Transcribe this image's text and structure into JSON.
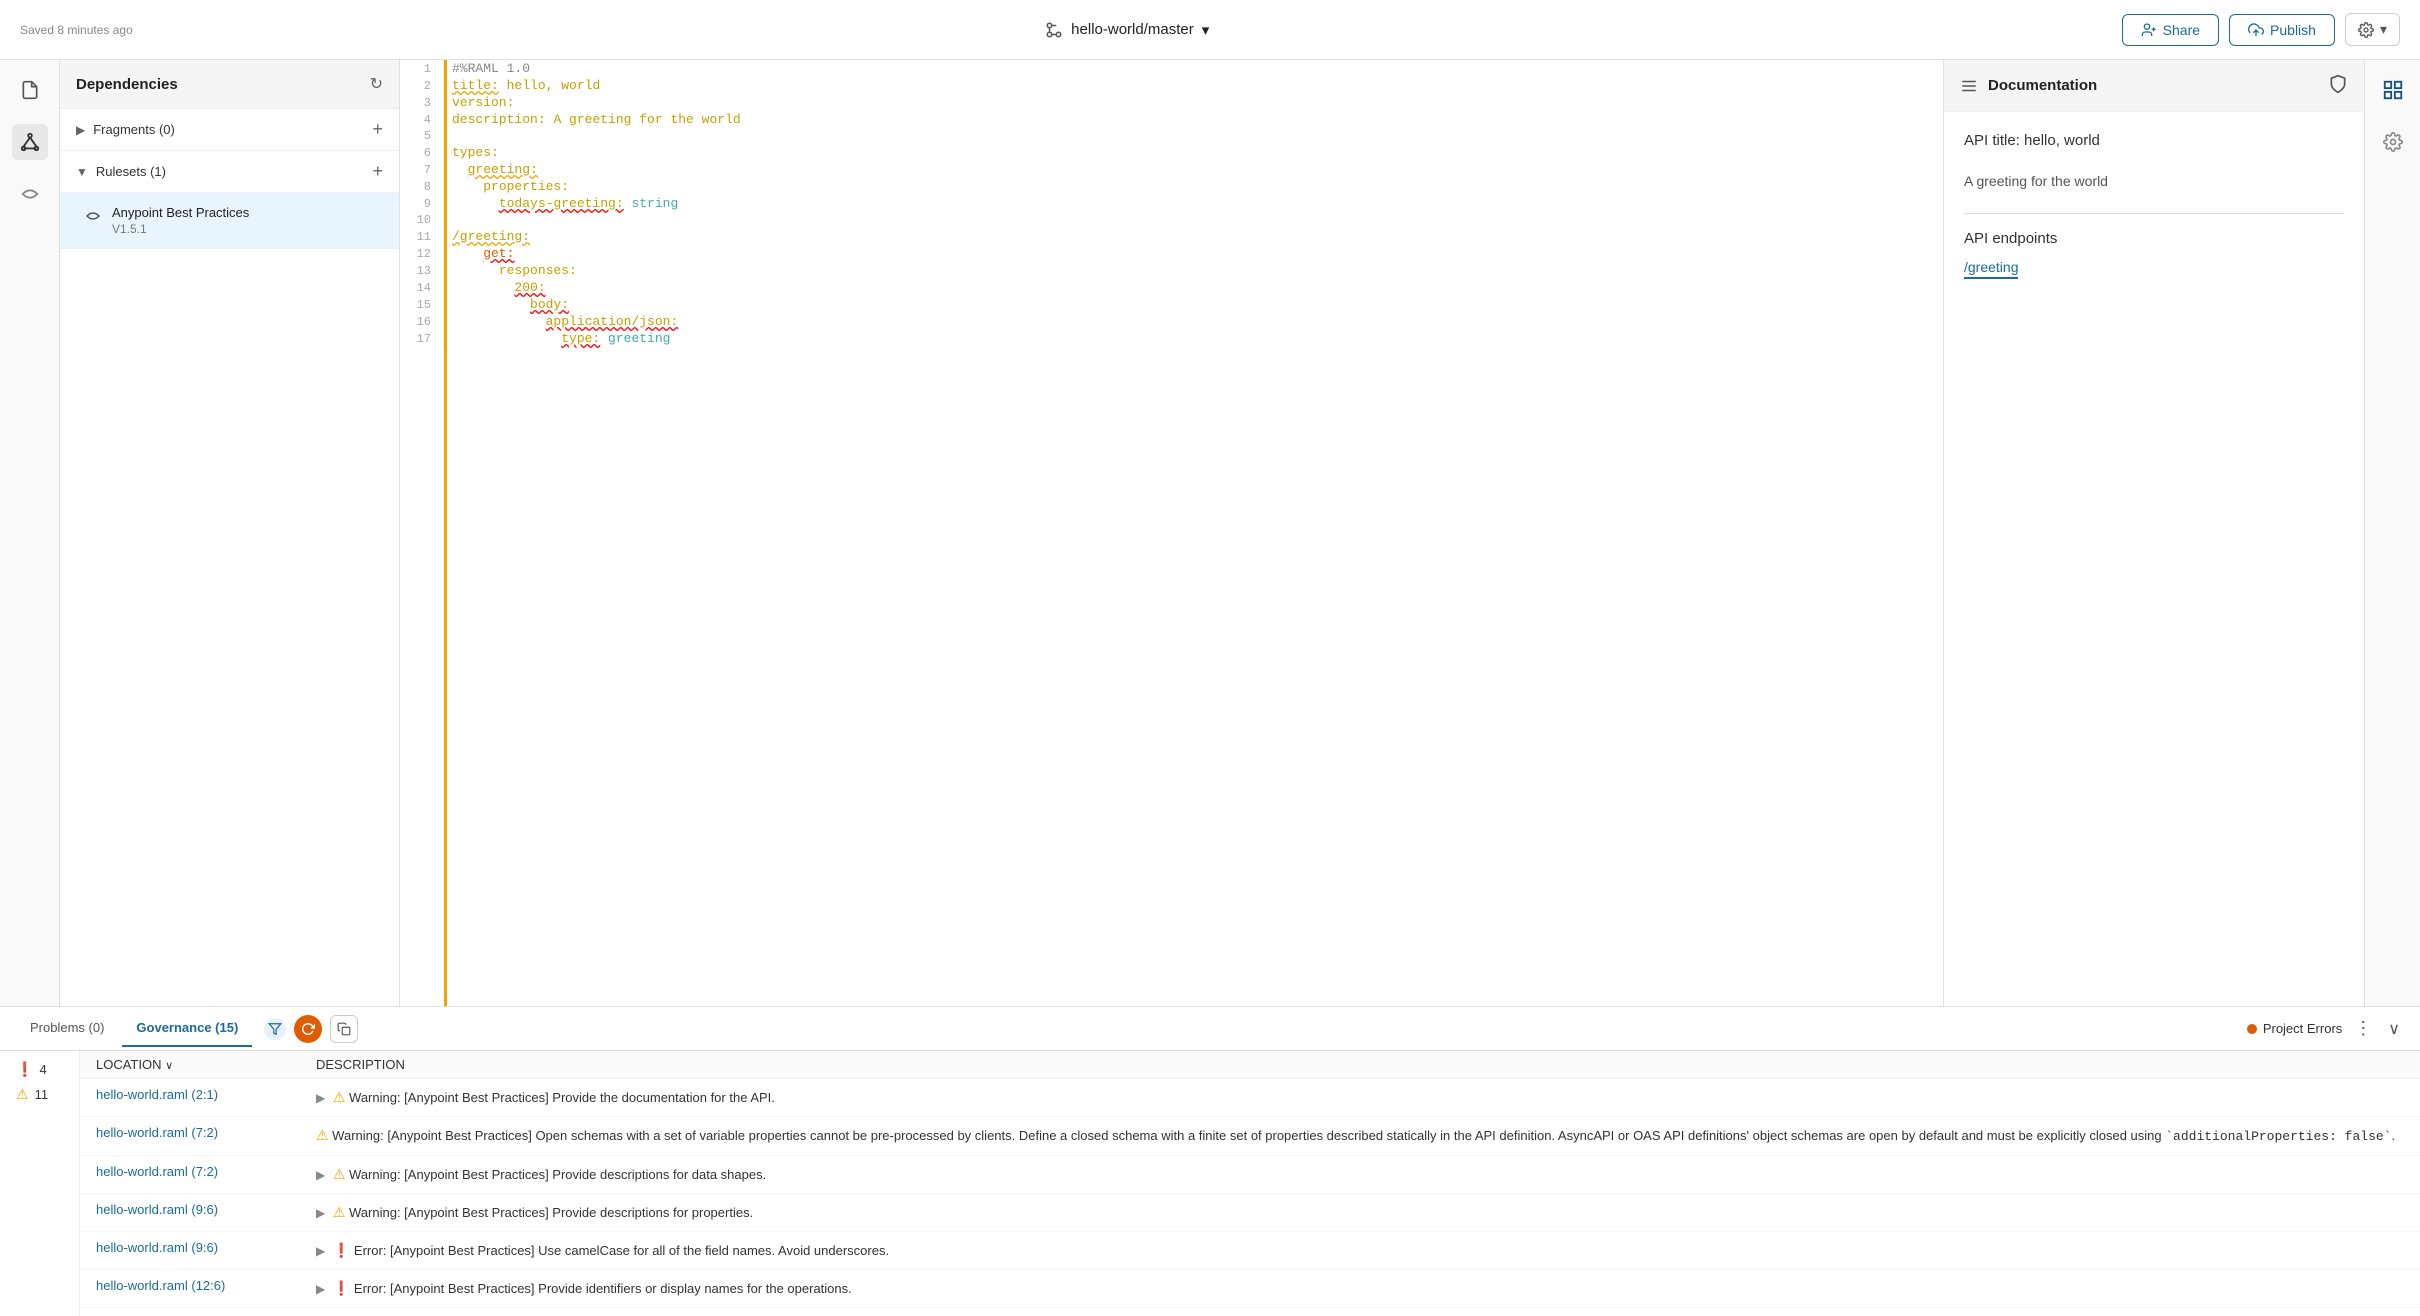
{
  "topbar": {
    "saved_text": "Saved 8 minutes ago",
    "repo": "hello-world/master",
    "share_label": "Share",
    "publish_label": "Publish"
  },
  "sidebar": {
    "icons": [
      "document",
      "graph",
      "anypoint"
    ]
  },
  "dependencies": {
    "title": "Dependencies",
    "fragments": {
      "label": "Fragments (0)",
      "count": 0
    },
    "rulesets": {
      "label": "Rulesets (1)",
      "count": 1
    },
    "ruleset_entry": {
      "name": "Anypoint Best Practices",
      "version": "V1.5.1"
    }
  },
  "editor": {
    "lines": [
      {
        "num": 1,
        "content": "#%RAML 1.0"
      },
      {
        "num": 2,
        "content": "title: hello, world"
      },
      {
        "num": 3,
        "content": "version:"
      },
      {
        "num": 4,
        "content": "description: A greeting for the world"
      },
      {
        "num": 5,
        "content": ""
      },
      {
        "num": 6,
        "content": "types:"
      },
      {
        "num": 7,
        "content": "  greeting:"
      },
      {
        "num": 8,
        "content": "    properties:"
      },
      {
        "num": 9,
        "content": "      todays-greeting: string"
      },
      {
        "num": 10,
        "content": ""
      },
      {
        "num": 11,
        "content": "/greeting:"
      },
      {
        "num": 12,
        "content": "    get:"
      },
      {
        "num": 13,
        "content": "      responses:"
      },
      {
        "num": 14,
        "content": "        200:"
      },
      {
        "num": 15,
        "content": "          body:"
      },
      {
        "num": 16,
        "content": "            application/json:"
      },
      {
        "num": 17,
        "content": "              type: greeting"
      }
    ]
  },
  "documentation": {
    "title": "Documentation",
    "api_title_label": "API title: hello, world",
    "description": "A greeting for the world",
    "endpoints_label": "API endpoints",
    "endpoint": "/greeting"
  },
  "bottom": {
    "tab_problems": "Problems (0)",
    "tab_governance": "Governance (15)",
    "project_errors_label": "Project Errors",
    "error_count": 4,
    "warning_count": 11,
    "col_location": "LOCATION",
    "col_description": "DESCRIPTION",
    "rows": [
      {
        "type": "warning",
        "location": "hello-world.raml (2:1)",
        "expand": true,
        "description": "⚠ Warning: [Anypoint Best Practices] Provide the documentation for the API."
      },
      {
        "type": "warning",
        "location": "hello-world.raml (7:2)",
        "expand": false,
        "description": "⚠ Warning: [Anypoint Best Practices] Open schemas with a set of variable properties cannot be pre-processed by clients. Define a closed schema with a finite set of properties described statically in the API definition. AsyncAPI or OAS API definitions' object schemas are open by default and must be explicitly closed using `additionalProperties: false`."
      },
      {
        "type": "warning",
        "location": "hello-world.raml (7:2)",
        "expand": true,
        "description": "⚠ Warning: [Anypoint Best Practices] Provide descriptions for data shapes."
      },
      {
        "type": "warning",
        "location": "hello-world.raml (9:6)",
        "expand": true,
        "description": "⚠ Warning: [Anypoint Best Practices] Provide descriptions for properties."
      },
      {
        "type": "error",
        "location": "hello-world.raml (9:6)",
        "expand": true,
        "description": "❌ Error: [Anypoint Best Practices] Use camelCase for all of the field names. Avoid underscores."
      },
      {
        "type": "error",
        "location": "hello-world.raml (12:6)",
        "expand": true,
        "description": "❌ Error: [Anypoint Best Practices] Provide identifiers or display names for the operations."
      }
    ]
  }
}
